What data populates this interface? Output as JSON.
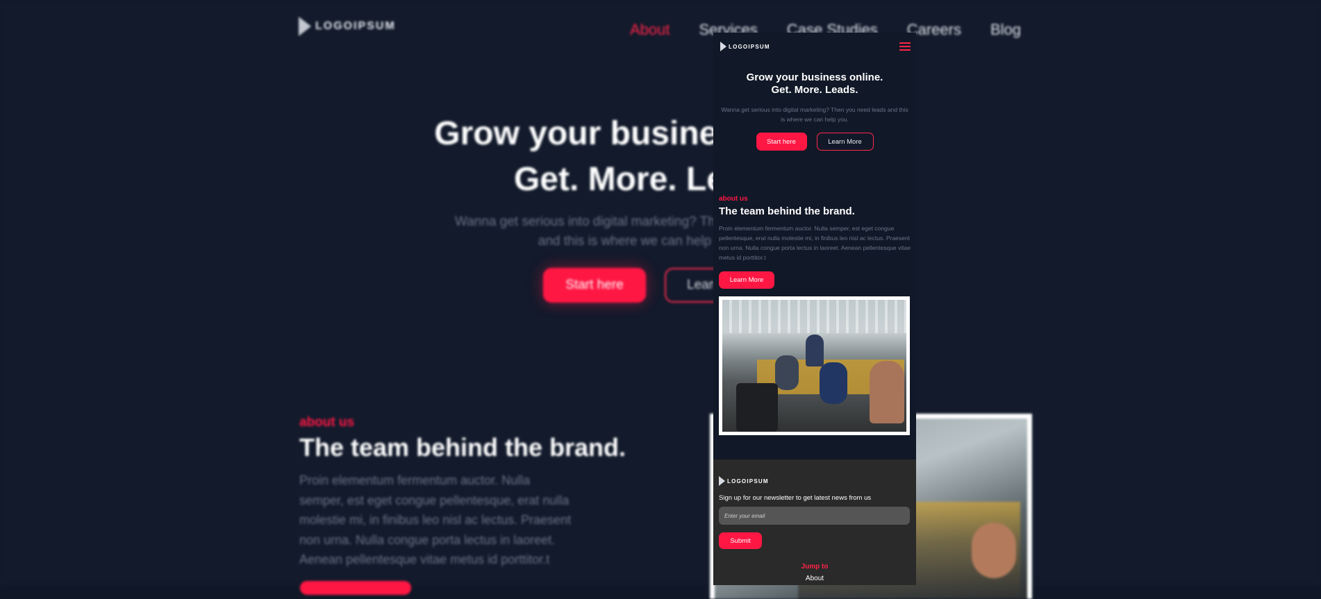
{
  "brand": {
    "logo_text": "LOGOIPSUM"
  },
  "nav": {
    "links": [
      "About",
      "Services",
      "Case Studies",
      "Careers",
      "Blog"
    ]
  },
  "hero": {
    "title_line1": "Grow your business online.",
    "title_line2": "Get. More. Leads.",
    "subtitle": "Wanna get serious into digital marketing? Then you need leads and this is where we can help you.",
    "primary_button": "Start here",
    "secondary_button": "Learn More"
  },
  "about": {
    "label": "about us",
    "title": "The team behind the brand.",
    "body": "Proin elementum fermentum auctor. Nulla semper, est eget congue pellentesque, erat nulla molestie mi, in finibus leo nisl ac lectus. Praesent non urna. Nulla congue porta lectus in laoreet. Aenean pellentesque vitae metus id porttitor.t",
    "button": "Learn More"
  },
  "footer": {
    "newsletter_text": "Sign up for our newsletter to get latest news from us",
    "email_placeholder": "Enter your email",
    "submit_label": "Submit",
    "jump_label": "Jump to",
    "jump_links": [
      "About"
    ]
  },
  "colors": {
    "accent": "#ff1744",
    "background": "#111827",
    "footer": "#2a2a2a"
  },
  "icons": [
    "logo-icon",
    "hamburger-menu-icon"
  ]
}
